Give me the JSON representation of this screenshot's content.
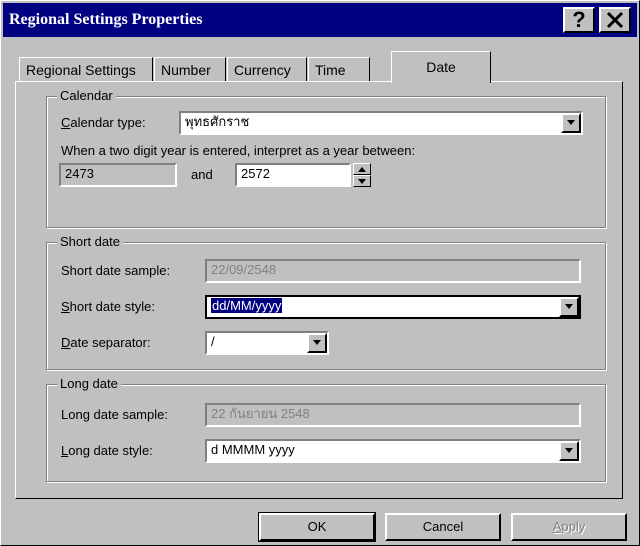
{
  "window": {
    "title": "Regional Settings Properties",
    "help_glyph": "?",
    "close_glyph": "✕"
  },
  "tabs": [
    {
      "label": "Regional Settings"
    },
    {
      "label": "Number"
    },
    {
      "label": "Currency"
    },
    {
      "label": "Time"
    },
    {
      "label": "Date",
      "active": true
    }
  ],
  "calendar": {
    "group_label": "Calendar",
    "type_label_u": "C",
    "type_label_rest": "alendar type:",
    "type_value": "พุทธศักราช",
    "interpret_text": "When a two digit year is entered, interpret as a year between:",
    "year_from": "2473",
    "and_label": "and",
    "year_to": "2572"
  },
  "short_date": {
    "group_label": "Short date",
    "sample_label": "Short date sample:",
    "sample_value": "22/09/2548",
    "style_label_u": "S",
    "style_label_rest": "hort date style:",
    "style_value": "dd/MM/yyyy",
    "separator_label_u": "D",
    "separator_label_rest": "ate separator:",
    "separator_value": "/"
  },
  "long_date": {
    "group_label": "Long date",
    "sample_label": "Long date sample:",
    "sample_value": "22 กันยายน 2548",
    "style_label_u": "L",
    "style_label_rest": "ong date style:",
    "style_value": "d MMMM yyyy"
  },
  "buttons": {
    "ok": "OK",
    "cancel": "Cancel",
    "apply_u": "A",
    "apply_rest": "pply"
  }
}
